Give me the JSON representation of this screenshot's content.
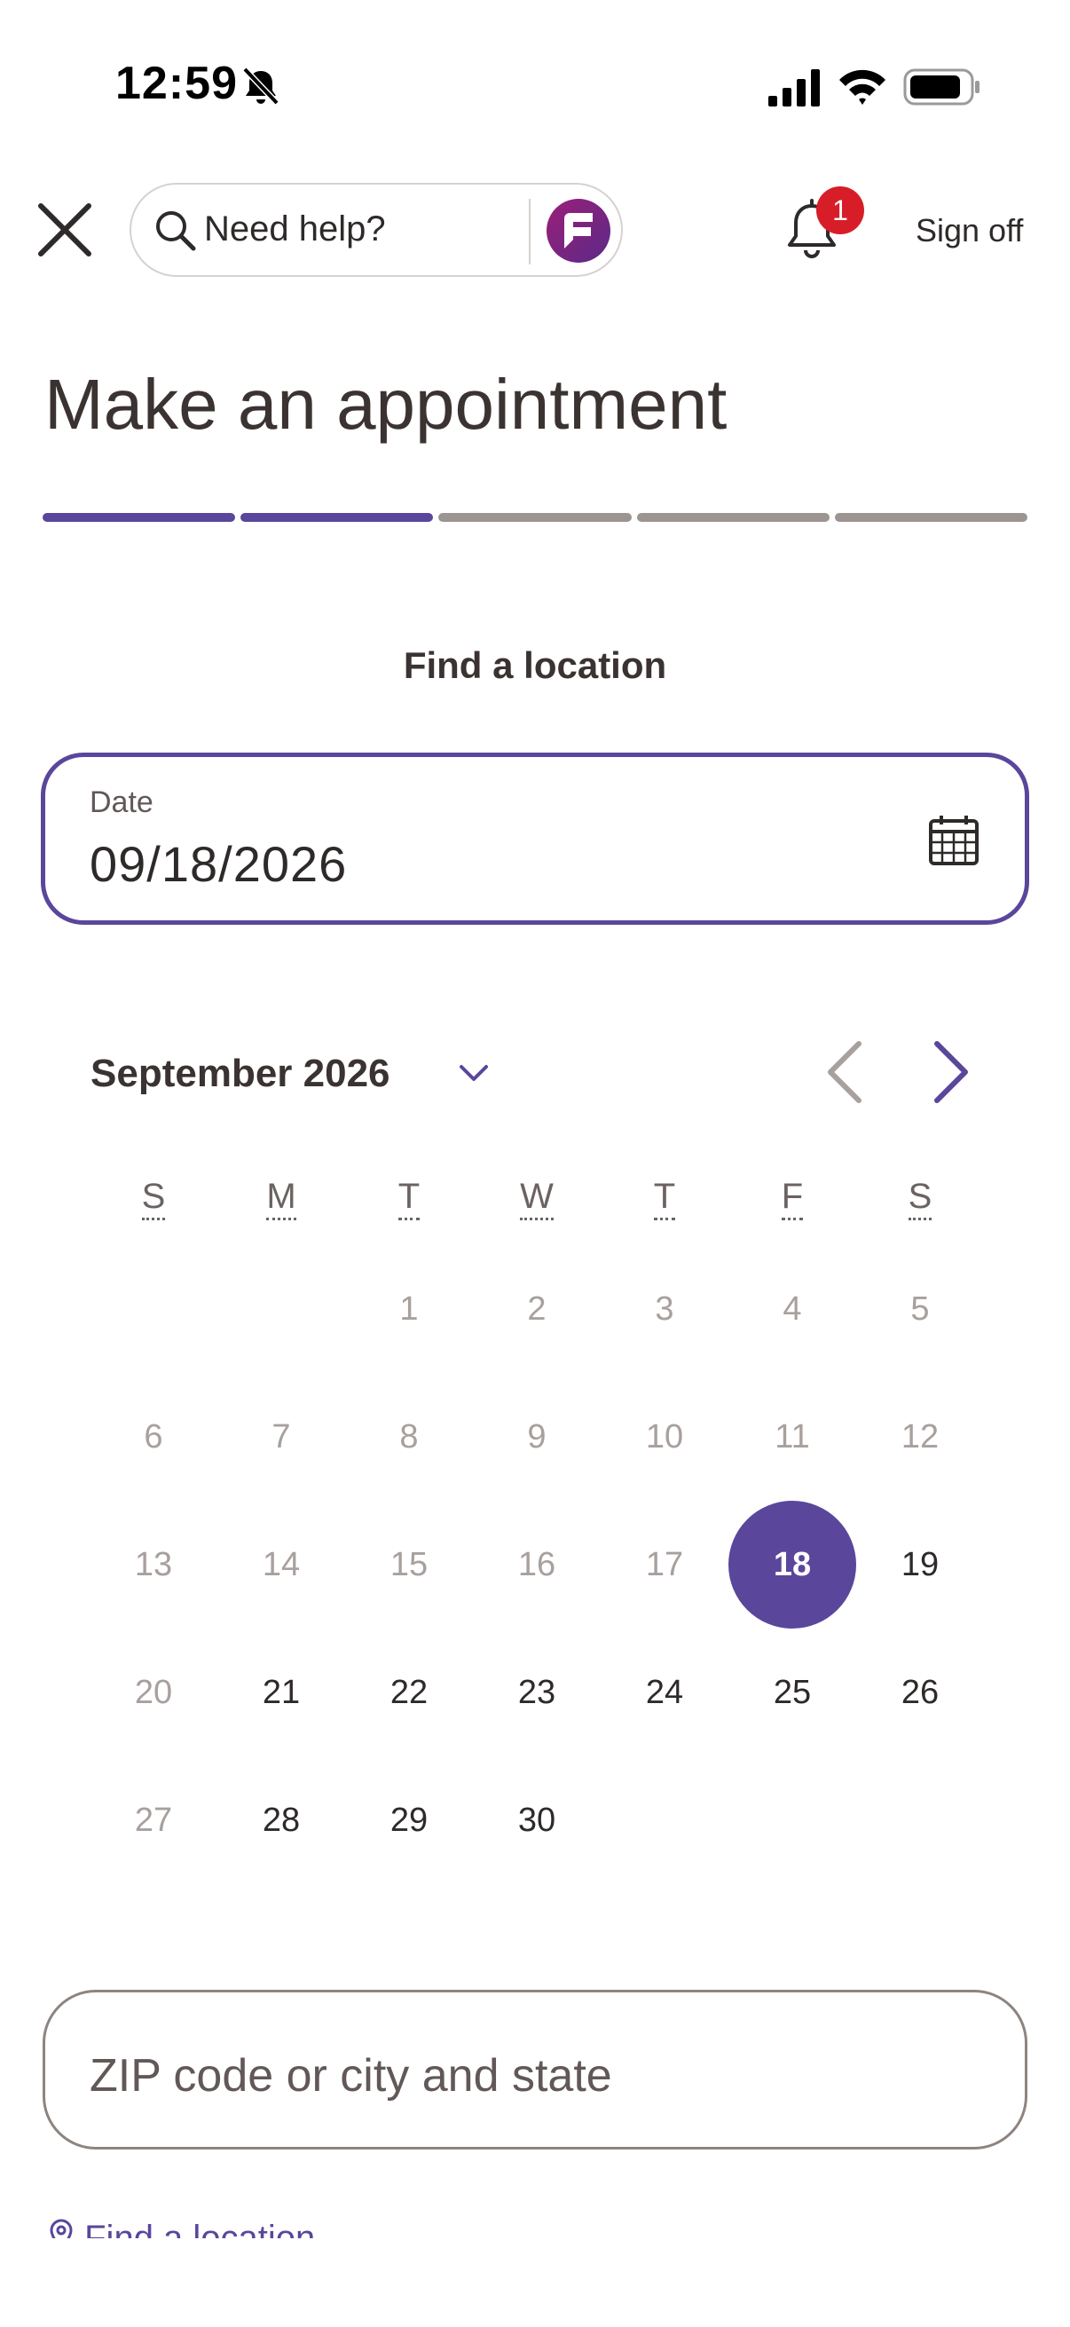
{
  "status_bar": {
    "time": "12:59"
  },
  "header": {
    "search_label": "Need help?",
    "notification_count": "1",
    "sign_off": "Sign off"
  },
  "page": {
    "title": "Make an appointment",
    "progress": {
      "total_steps": 5,
      "completed_steps": 2
    },
    "section_label": "Find a location"
  },
  "date_field": {
    "label": "Date",
    "value": "09/18/2026"
  },
  "calendar": {
    "month_label": "September 2026",
    "weekdays": [
      "S",
      "M",
      "T",
      "W",
      "T",
      "F",
      "S"
    ],
    "selected_day": 18,
    "days": [
      {
        "d": "",
        "state": "empty"
      },
      {
        "d": "",
        "state": "empty"
      },
      {
        "d": "1",
        "state": "disabled"
      },
      {
        "d": "2",
        "state": "disabled"
      },
      {
        "d": "3",
        "state": "disabled"
      },
      {
        "d": "4",
        "state": "disabled"
      },
      {
        "d": "5",
        "state": "disabled"
      },
      {
        "d": "6",
        "state": "disabled"
      },
      {
        "d": "7",
        "state": "disabled"
      },
      {
        "d": "8",
        "state": "disabled"
      },
      {
        "d": "9",
        "state": "disabled"
      },
      {
        "d": "10",
        "state": "disabled"
      },
      {
        "d": "11",
        "state": "disabled"
      },
      {
        "d": "12",
        "state": "disabled"
      },
      {
        "d": "13",
        "state": "disabled"
      },
      {
        "d": "14",
        "state": "disabled"
      },
      {
        "d": "15",
        "state": "disabled"
      },
      {
        "d": "16",
        "state": "disabled"
      },
      {
        "d": "17",
        "state": "disabled"
      },
      {
        "d": "18",
        "state": "selected"
      },
      {
        "d": "19",
        "state": "enabled"
      },
      {
        "d": "20",
        "state": "disabled"
      },
      {
        "d": "21",
        "state": "enabled"
      },
      {
        "d": "22",
        "state": "enabled"
      },
      {
        "d": "23",
        "state": "enabled"
      },
      {
        "d": "24",
        "state": "enabled"
      },
      {
        "d": "25",
        "state": "enabled"
      },
      {
        "d": "26",
        "state": "enabled"
      },
      {
        "d": "27",
        "state": "disabled"
      },
      {
        "d": "28",
        "state": "enabled"
      },
      {
        "d": "29",
        "state": "enabled"
      },
      {
        "d": "30",
        "state": "enabled"
      }
    ]
  },
  "zip_field": {
    "placeholder": "ZIP code or city and state"
  },
  "find_link": {
    "label": "Find a location"
  },
  "colors": {
    "accent": "#5a469b",
    "badge": "#d71e28",
    "disabled_text": "#a8a09d",
    "progress_inactive": "#9c9491"
  },
  "icons": [
    "bell-slash-icon",
    "signal-icon",
    "wifi-icon",
    "battery-icon",
    "close-icon",
    "search-icon",
    "fargo-logo-icon",
    "notification-bell-icon",
    "calendar-icon",
    "chevron-down-icon",
    "chevron-left-icon",
    "chevron-right-icon",
    "location-pin-icon"
  ]
}
